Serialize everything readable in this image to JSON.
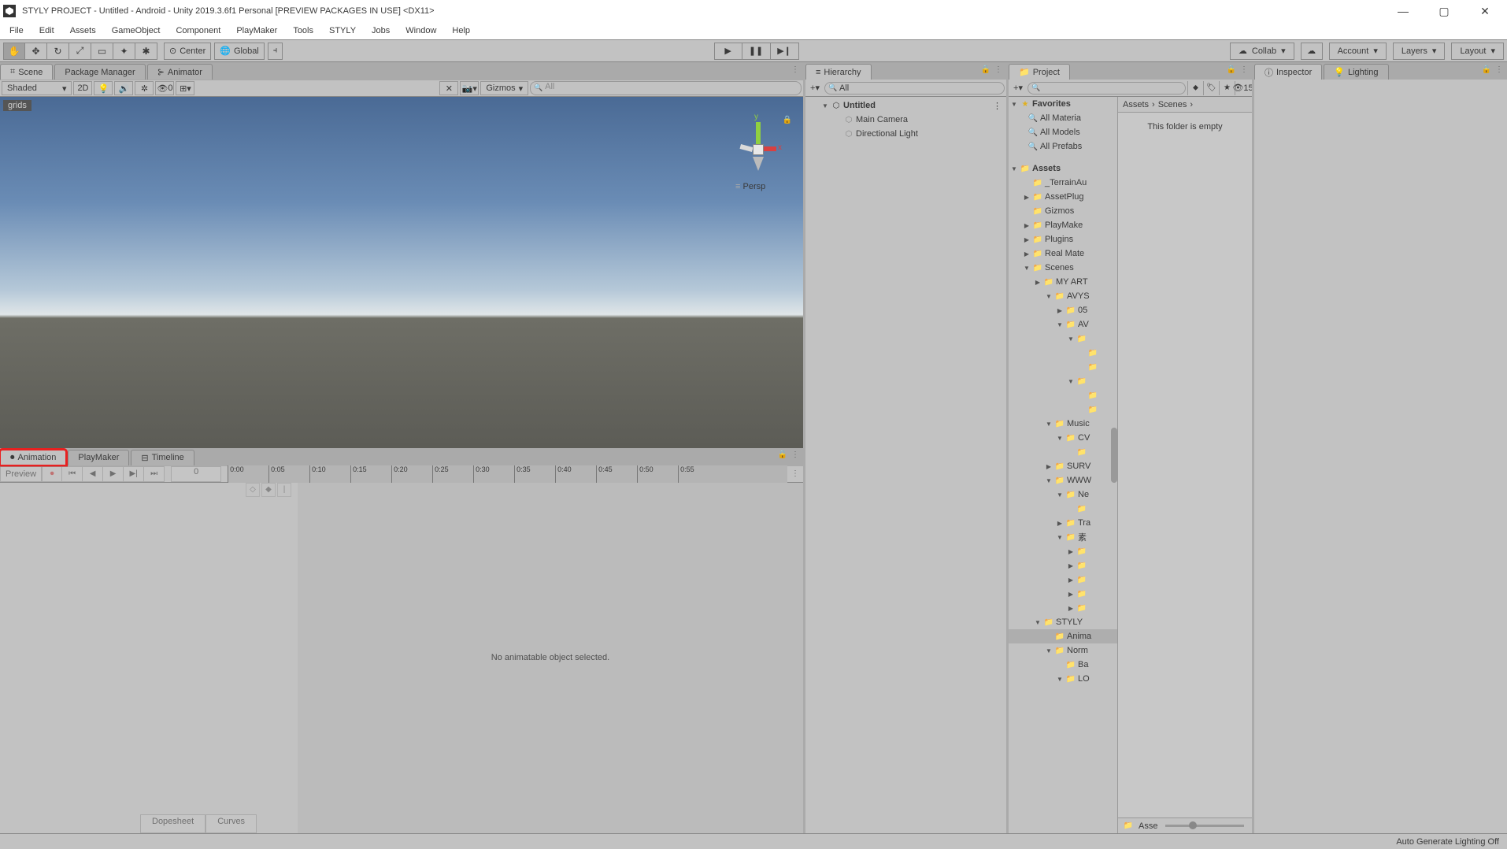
{
  "window": {
    "title": "STYLY PROJECT - Untitled - Android - Unity 2019.3.6f1 Personal [PREVIEW PACKAGES IN USE] <DX11>",
    "minimize": "—",
    "maximize": "▢",
    "close": "✕"
  },
  "menubar": [
    "File",
    "Edit",
    "Assets",
    "GameObject",
    "Component",
    "PlayMaker",
    "Tools",
    "STYLY",
    "Jobs",
    "Window",
    "Help"
  ],
  "toolbar": {
    "center": "Center",
    "global": "Global",
    "collab": "Collab",
    "account": "Account",
    "layers": "Layers",
    "layout": "Layout"
  },
  "scene_tabs": {
    "scene": "Scene",
    "packageManager": "Package Manager",
    "animator": "Animator"
  },
  "scene_tb": {
    "shaded": "Shaded",
    "twoD": "2D",
    "hidden_count": "0",
    "gizmos": "Gizmos",
    "search_placeholder": "All"
  },
  "scene_view": {
    "grids": "grids",
    "persp": "Persp"
  },
  "bottom_tabs": {
    "animation": "Animation",
    "playmaker": "PlayMaker",
    "timeline": "Timeline"
  },
  "animation": {
    "preview": "Preview",
    "frame": "0",
    "ticks": [
      "0:00",
      "0:05",
      "0:10",
      "0:15",
      "0:20",
      "0:25",
      "0:30",
      "0:35",
      "0:40",
      "0:45",
      "0:50",
      "0:55"
    ],
    "message": "No animatable object selected.",
    "dopesheet": "Dopesheet",
    "curves": "Curves"
  },
  "hierarchy": {
    "tab": "Hierarchy",
    "search_placeholder": "All",
    "scene": "Untitled",
    "items": [
      "Main Camera",
      "Directional Light"
    ]
  },
  "project": {
    "tab": "Project",
    "search_placeholder": "",
    "hidden": "15",
    "favorites": "Favorites",
    "fav_items": [
      "All Materia",
      "All Models",
      "All Prefabs"
    ],
    "assets": "Assets",
    "tree": [
      {
        "indent": 1,
        "fold": "",
        "label": "_TerrainAu"
      },
      {
        "indent": 1,
        "fold": "▶",
        "label": "AssetPlug"
      },
      {
        "indent": 1,
        "fold": "",
        "label": "Gizmos"
      },
      {
        "indent": 1,
        "fold": "▶",
        "label": "PlayMake"
      },
      {
        "indent": 1,
        "fold": "▶",
        "label": "Plugins"
      },
      {
        "indent": 1,
        "fold": "▶",
        "label": "Real Mate"
      },
      {
        "indent": 1,
        "fold": "▼",
        "label": "Scenes"
      },
      {
        "indent": 2,
        "fold": "▶",
        "label": "MY ART"
      },
      {
        "indent": 3,
        "fold": "▼",
        "label": "AVYS"
      },
      {
        "indent": 4,
        "fold": "▶",
        "label": "05"
      },
      {
        "indent": 4,
        "fold": "▼",
        "label": "AV"
      },
      {
        "indent": 5,
        "fold": "▼",
        "label": ""
      },
      {
        "indent": 6,
        "fold": "",
        "label": ""
      },
      {
        "indent": 6,
        "fold": "",
        "label": ""
      },
      {
        "indent": 5,
        "fold": "▼",
        "label": ""
      },
      {
        "indent": 6,
        "fold": "",
        "label": ""
      },
      {
        "indent": 6,
        "fold": "",
        "label": ""
      },
      {
        "indent": 3,
        "fold": "▼",
        "label": "Music"
      },
      {
        "indent": 4,
        "fold": "▼",
        "label": "CV"
      },
      {
        "indent": 5,
        "fold": "",
        "label": ""
      },
      {
        "indent": 3,
        "fold": "▶",
        "label": "SURV"
      },
      {
        "indent": 3,
        "fold": "▼",
        "label": "WWW"
      },
      {
        "indent": 4,
        "fold": "▼",
        "label": "Ne"
      },
      {
        "indent": 5,
        "fold": "",
        "label": ""
      },
      {
        "indent": 4,
        "fold": "▶",
        "label": "Tra"
      },
      {
        "indent": 4,
        "fold": "▼",
        "label": "素"
      },
      {
        "indent": 5,
        "fold": "▶",
        "label": ""
      },
      {
        "indent": 5,
        "fold": "▶",
        "label": ""
      },
      {
        "indent": 5,
        "fold": "▶",
        "label": ""
      },
      {
        "indent": 5,
        "fold": "▶",
        "label": ""
      },
      {
        "indent": 5,
        "fold": "▶",
        "label": ""
      },
      {
        "indent": 2,
        "fold": "▼",
        "label": "STYLY"
      },
      {
        "indent": 3,
        "fold": "",
        "label": "Anima",
        "hl": true
      },
      {
        "indent": 3,
        "fold": "▼",
        "label": "Norm"
      },
      {
        "indent": 4,
        "fold": "",
        "label": "Ba"
      },
      {
        "indent": 4,
        "fold": "▼",
        "label": "LO"
      }
    ],
    "breadcrumb": [
      "Assets",
      "Scenes"
    ],
    "empty_msg": "This folder is empty",
    "bottom_label": "Asse"
  },
  "inspector": {
    "tab": "Inspector",
    "lighting": "Lighting"
  },
  "statusbar": {
    "text": "Auto Generate Lighting Off"
  }
}
